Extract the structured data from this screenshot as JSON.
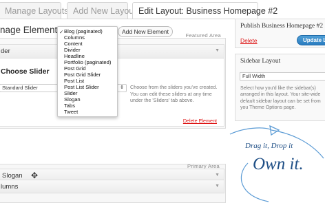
{
  "tabs": [
    {
      "label": "Manage Layouts"
    },
    {
      "label": "Add New Layout"
    },
    {
      "label": "Edit Layout: Business Homepage #2"
    }
  ],
  "manage": {
    "title": "nage Elements",
    "add_button": "Add New Element"
  },
  "featured_area": {
    "label": "Featured Area",
    "block_title": "der",
    "choose_title": "Choose Slider",
    "select_value": "Standard Slider",
    "help_text": "Choose from the sliders you've created. You can edit these sliders at any time under the 'Sliders' tab above.",
    "delete_label": "Delete Element"
  },
  "dropdown": {
    "selected": "Blog (paginated)",
    "options": [
      "Blog (paginated)",
      "Columns",
      "Content",
      "Divider",
      "Headline",
      "Portfolio (paginated)",
      "Post Grid",
      "Post Grid Slider",
      "Post List",
      "Post List Slider",
      "Slider",
      "Slogan",
      "Tabs",
      "Tweet"
    ]
  },
  "primary_area": {
    "label": "Primary Area",
    "slogan_title": "Slogan",
    "columns_title": "lumns"
  },
  "publish": {
    "title": "Publish Business Homepage #2",
    "delete_label": "Delete",
    "update_label": "Update Lay"
  },
  "sidebar_layout": {
    "title": "Sidebar Layout",
    "select_value": "Full Width",
    "help_text": "Select how you'd like the sidebar(s) arranged in this layout. Your site-wide default sidebar layout can be set from you Theme Options page."
  },
  "promo": {
    "line1": "Drag it, Drop it",
    "line2": "Own it."
  },
  "colors": {
    "accent_blue": "#2a7cc0",
    "delete_red": "#dd1111",
    "script_blue": "#1f4f86"
  },
  "icons": [
    "move-icon",
    "chevron-down-icon",
    "checkmark-icon"
  ]
}
